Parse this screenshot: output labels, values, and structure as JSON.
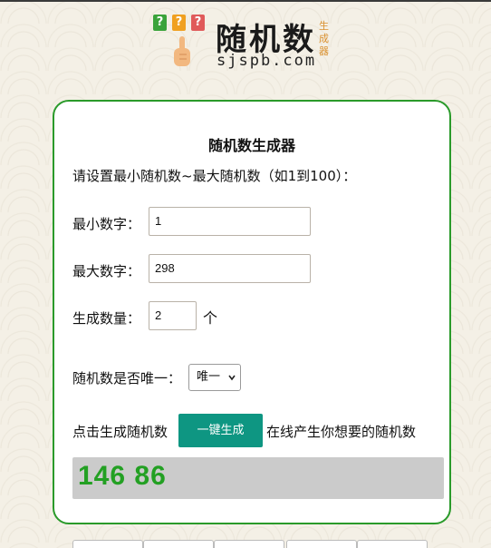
{
  "logo": {
    "badges": [
      "?",
      "?",
      "?"
    ],
    "main_text": "随机数",
    "side_text": "生成器",
    "url": "sjspb.com"
  },
  "card": {
    "title": "随机数生成器",
    "prompt": "请设置最小随机数~最大随机数（如1到100）：",
    "min_label": "最小数字：",
    "min_value": "1",
    "max_label": "最大数字：",
    "max_value": "298",
    "count_label": "生成数量：",
    "count_value": "2",
    "count_unit": "个",
    "unique_label": "随机数是否唯一：",
    "unique_selected": "唯一",
    "action_prefix": "点击生成随机数",
    "generate_button": "一键生成",
    "action_suffix": "在线产生你想要的随机数",
    "result": "146 86"
  },
  "colors": {
    "accent_green": "#2a9a2a",
    "button_teal": "#0e9682",
    "result_text": "#23a023",
    "result_bg": "#cbcbcb"
  }
}
